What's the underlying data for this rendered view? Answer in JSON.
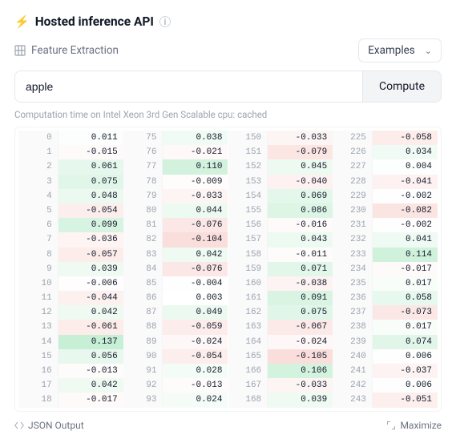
{
  "header": {
    "title": "Hosted inference API"
  },
  "task": {
    "label": "Feature Extraction",
    "examples_label": "Examples"
  },
  "input": {
    "value": "apple",
    "compute_label": "Compute"
  },
  "caption": "Computation time on Intel Xeon 3rd Gen Scalable cpu: cached",
  "footer": {
    "json_label": "JSON Output",
    "maximize_label": "Maximize"
  },
  "colors": {
    "pos_max": "#c7efd6",
    "neg_max": "#f8d4d0"
  },
  "columns": [
    {
      "start": 0,
      "values": [
        0.011,
        -0.015,
        0.061,
        0.075,
        0.048,
        -0.054,
        0.099,
        -0.036,
        -0.057,
        0.039,
        -0.006,
        -0.044,
        0.042,
        -0.061,
        0.137,
        0.056,
        -0.013,
        0.042,
        -0.017
      ]
    },
    {
      "start": 75,
      "values": [
        0.038,
        -0.021,
        0.11,
        -0.009,
        -0.033,
        0.044,
        -0.076,
        -0.104,
        0.042,
        -0.076,
        -0.004,
        0.003,
        0.049,
        -0.059,
        -0.024,
        -0.054,
        0.028,
        -0.013,
        0.024
      ]
    },
    {
      "start": 150,
      "values": [
        -0.033,
        -0.079,
        0.045,
        -0.04,
        0.069,
        0.086,
        -0.016,
        0.043,
        -0.011,
        0.071,
        -0.038,
        0.091,
        0.075,
        -0.067,
        -0.024,
        -0.105,
        0.106,
        -0.033,
        0.039
      ]
    },
    {
      "start": 225,
      "values": [
        -0.058,
        0.034,
        0.004,
        -0.041,
        -0.002,
        -0.082,
        -0.002,
        0.041,
        0.114,
        -0.017,
        0.017,
        0.058,
        -0.073,
        0.017,
        0.074,
        0.006,
        -0.037,
        0.006,
        -0.051
      ]
    }
  ]
}
